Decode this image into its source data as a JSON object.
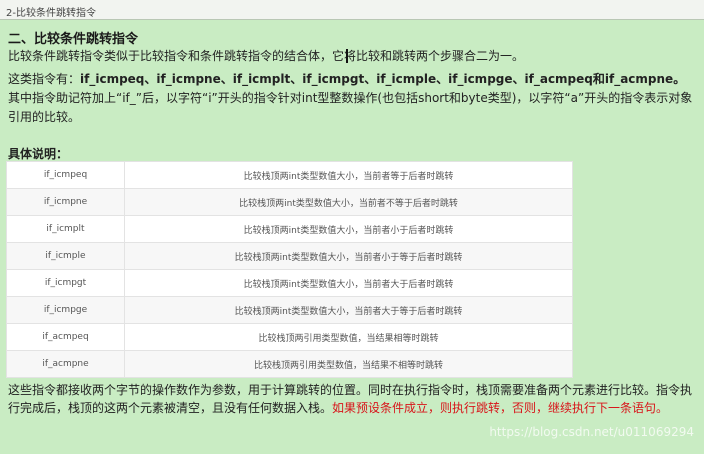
{
  "window": {
    "title": "2-比较条件跳转指令"
  },
  "section": {
    "heading": "二、比较条件跳转指令"
  },
  "paragraphs": {
    "intro": "比较条件跳转指令类似于比较指令和条件跳转指令的结合体，它将比较和跳转两个步骤合二为一。",
    "p2_prefix": "这类指令有：",
    "p2_codes": "if_icmpeq、if_icmpne、if_icmplt、if_icmpgt、if_icmple、if_icmpge、if_acmpeq和if_acmpne。",
    "p2_body": "其中指令助记符加上“if_”后，以字符“i”开头的指令针对int型整数操作(也包括short和byte类型)，以字符“a”开头的指令表示对象引用的比较。"
  },
  "details": {
    "heading": "具体说明："
  },
  "instructions": [
    {
      "opcode": "if_icmpeq",
      "desc": "比较栈顶两int类型数值大小，当前者等于后者时跳转"
    },
    {
      "opcode": "if_icmpne",
      "desc": "比较栈顶两int类型数值大小，当前者不等于后者时跳转"
    },
    {
      "opcode": "if_icmplt",
      "desc": "比较栈顶两int类型数值大小，当前者小于后者时跳转"
    },
    {
      "opcode": "if_icmple",
      "desc": "比较栈顶两int类型数值大小，当前者小于等于后者时跳转"
    },
    {
      "opcode": "if_icmpgt",
      "desc": "比较栈顶两int类型数值大小，当前者大于后者时跳转"
    },
    {
      "opcode": "if_icmpge",
      "desc": "比较栈顶两int类型数值大小，当前者大于等于后者时跳转"
    },
    {
      "opcode": "if_acmpeq",
      "desc": "比较栈顶两引用类型数值，当结果相等时跳转"
    },
    {
      "opcode": "if_acmpne",
      "desc": "比较栈顶两引用类型数值，当结果不相等时跳转"
    }
  ],
  "footer": {
    "text": "这些指令都接收两个字节的操作数作为参数，用于计算跳转的位置。同时在执行指令时，栈顶需要准备两个元素进行比较。指令执行完成后，栈顶的这两个元素被清空，且没有任何数据入栈。",
    "highlight": "如果预设条件成立，则执行跳转，否则，继续执行下一条语句。"
  },
  "watermark": "https://blog.csdn.net/u011069294",
  "colors": {
    "background": "#c9ecc3",
    "highlight": "#d8141a"
  }
}
